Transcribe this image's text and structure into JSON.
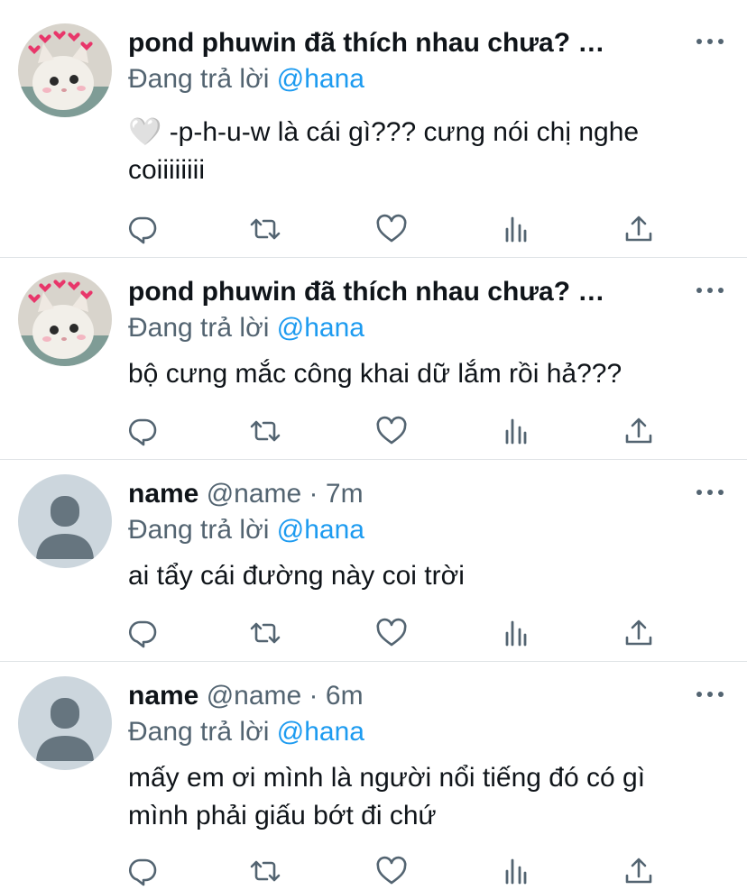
{
  "tweets": [
    {
      "avatar": "cat-with-hearts",
      "name": "pond phuwin đã thích nhau chưa? …",
      "handle": "",
      "sep": "",
      "time": "",
      "reply_prefix": "Đang trả lời ",
      "reply_mention": "@hana",
      "text_lines": [
        "🤍 -p-h-u-w là cái gì??? cưng nói chị nghe",
        "coiiiiiiii"
      ]
    },
    {
      "avatar": "cat-with-hearts",
      "name": "pond phuwin đã thích nhau chưa? …",
      "handle": "",
      "sep": "",
      "time": "",
      "reply_prefix": "Đang trả lời ",
      "reply_mention": "@hana",
      "text_lines": [
        "bộ cưng mắc công khai dữ lắm rồi hả???"
      ]
    },
    {
      "avatar": "default-user",
      "name": "name",
      "handle": "@name",
      "sep": " · ",
      "time": "7m",
      "reply_prefix": "Đang trả lời ",
      "reply_mention": "@hana",
      "text_lines": [
        "ai tẩy cái đường này coi trời"
      ]
    },
    {
      "avatar": "default-user",
      "name": "name",
      "handle": "@name",
      "sep": " · ",
      "time": "6m",
      "reply_prefix": "Đang trả lời ",
      "reply_mention": "@hana",
      "text_lines": [
        "mấy em ơi mình là người nổi tiếng đó có gì",
        "mình phải giấu bớt đi chứ"
      ]
    }
  ],
  "action_icons": [
    "reply-icon",
    "retweet-icon",
    "like-icon",
    "analytics-icon",
    "share-icon"
  ],
  "colors": {
    "text": "#0f1419",
    "secondary": "#536471",
    "link": "#1d9bf0",
    "divider": "#dfe3e6",
    "avatar_default_bg": "#ccd6dd",
    "avatar_default_fg": "#66757f"
  }
}
